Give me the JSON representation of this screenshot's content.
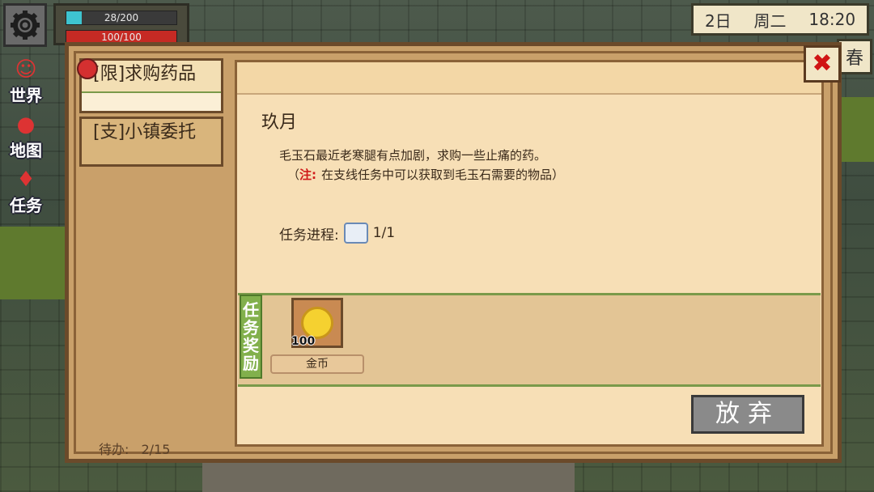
{
  "hud": {
    "stamina_text": "28/200",
    "stamina_fraction": 0.14,
    "health_text": "100/100",
    "health_fraction": 1.0
  },
  "sidenav": [
    {
      "label": "世界",
      "icon": "people-icon"
    },
    {
      "label": "地图",
      "icon": "map-pin-icon"
    },
    {
      "label": "任务",
      "icon": "quest-marker-icon"
    }
  ],
  "date": {
    "day": "2日",
    "weekday": "周二",
    "time": "18:20",
    "season": "春"
  },
  "quest_list": {
    "items": [
      {
        "label": "[限]求购药品",
        "active": true
      },
      {
        "label": "[支]小镇委托",
        "active": false
      }
    ],
    "pending_label": "待办:",
    "pending_count": "2/15"
  },
  "quest_detail": {
    "npc_name": "玖月",
    "description": "毛玉石最近老寒腿有点加剧，求购一些止痛的药。",
    "note_open": "（",
    "note_prefix": "注:",
    "note_text": "在支线任务中可以获取到毛玉石需要的物品）",
    "progress_label": "任务进程:",
    "progress_value": "1/1"
  },
  "rewards": {
    "section_label": "任务奖励",
    "items": [
      {
        "name": "金币",
        "count": "100",
        "icon": "gold-coin-icon"
      }
    ]
  },
  "actions": {
    "abandon_label": "放弃",
    "close_icon": "close-icon"
  }
}
